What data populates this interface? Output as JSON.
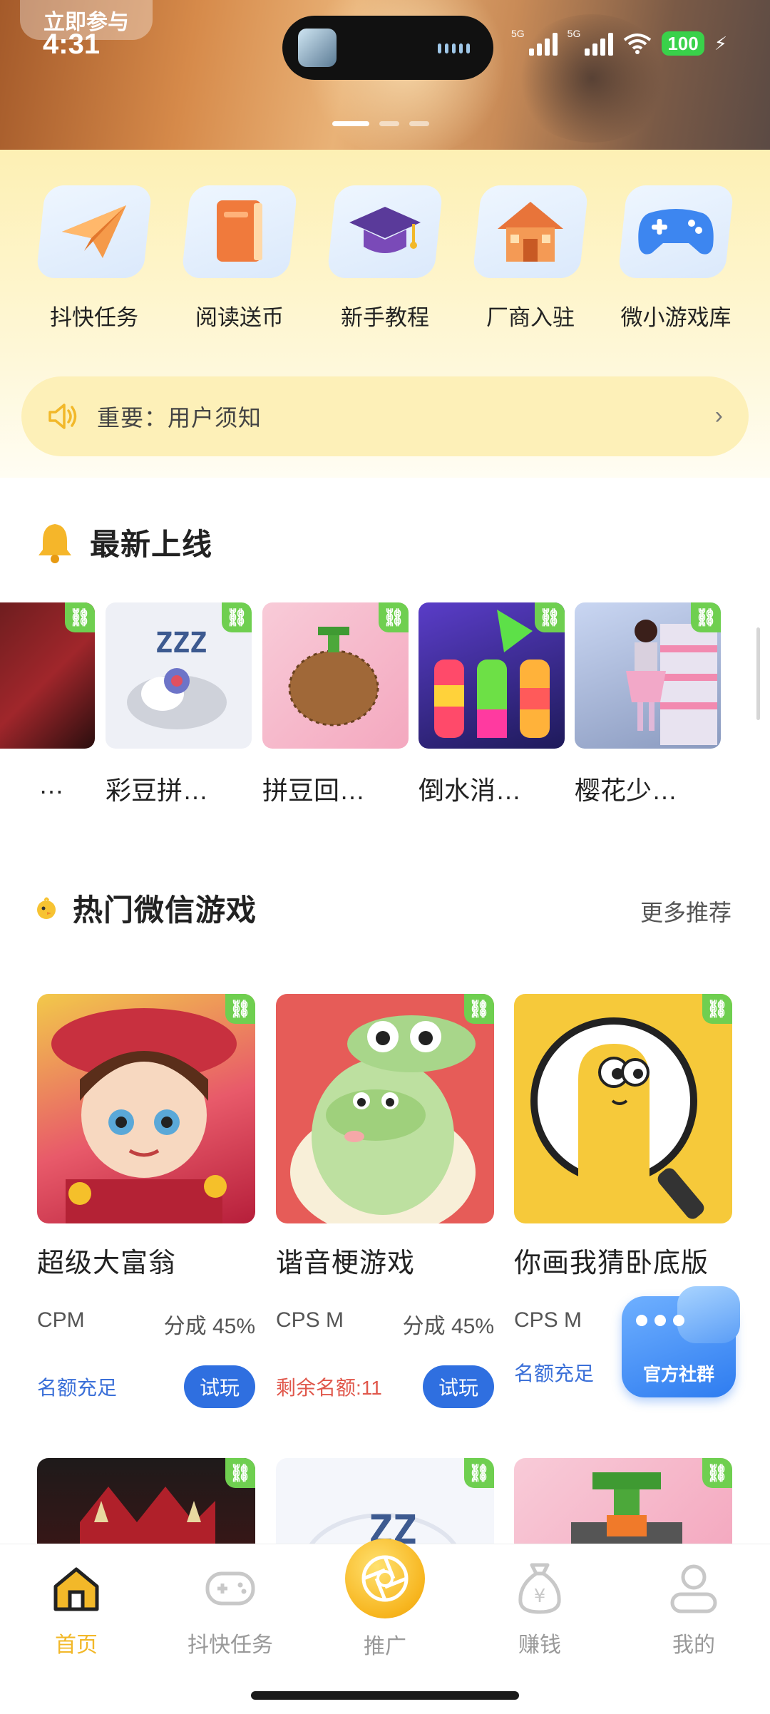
{
  "banner": {
    "join_label": "立即参与",
    "time": "4:31",
    "signal1_label": "5G",
    "signal2_label": "5G",
    "battery": "100"
  },
  "quick_entries": [
    {
      "label": "抖快任务",
      "icon": "paper-plane-icon"
    },
    {
      "label": "阅读送币",
      "icon": "book-icon"
    },
    {
      "label": "新手教程",
      "icon": "graduation-cap-icon"
    },
    {
      "label": "厂商入驻",
      "icon": "house-icon"
    },
    {
      "label": "微小游戏库",
      "icon": "gamepad-icon"
    }
  ],
  "notice": {
    "text": "重要：用户须知"
  },
  "latest": {
    "title": "最新上线",
    "games": [
      {
        "name": "…"
      },
      {
        "name": "彩豆拼…"
      },
      {
        "name": "拼豆回…"
      },
      {
        "name": "倒水消…"
      },
      {
        "name": "樱花少…"
      }
    ]
  },
  "hot": {
    "title": "热门微信游戏",
    "more": "更多推荐",
    "games": [
      {
        "name": "超级大富翁",
        "model": "CPM",
        "share": "分成 45%",
        "quota": "名额充足",
        "try": "试玩"
      },
      {
        "name": "谐音梗游戏",
        "model": "CPS M",
        "share": "分成 45%",
        "quota": "剩余名额:11",
        "try": "试玩"
      },
      {
        "name": "你画我猜卧底版",
        "model": "CPS M",
        "share": "",
        "quota": "名额充足",
        "try": ""
      }
    ]
  },
  "community": {
    "label": "官方社群"
  },
  "nav": [
    {
      "label": "首页",
      "icon": "home-icon"
    },
    {
      "label": "抖快任务",
      "icon": "gamepad-icon"
    },
    {
      "label": "推广",
      "icon": "aperture-icon"
    },
    {
      "label": "赚钱",
      "icon": "money-bag-icon"
    },
    {
      "label": "我的",
      "icon": "user-icon"
    }
  ],
  "colors": {
    "accent": "#f2b829",
    "link_badge": "#6fcf50",
    "try_button": "#2f6fe0",
    "quota_red": "#e0584c"
  }
}
